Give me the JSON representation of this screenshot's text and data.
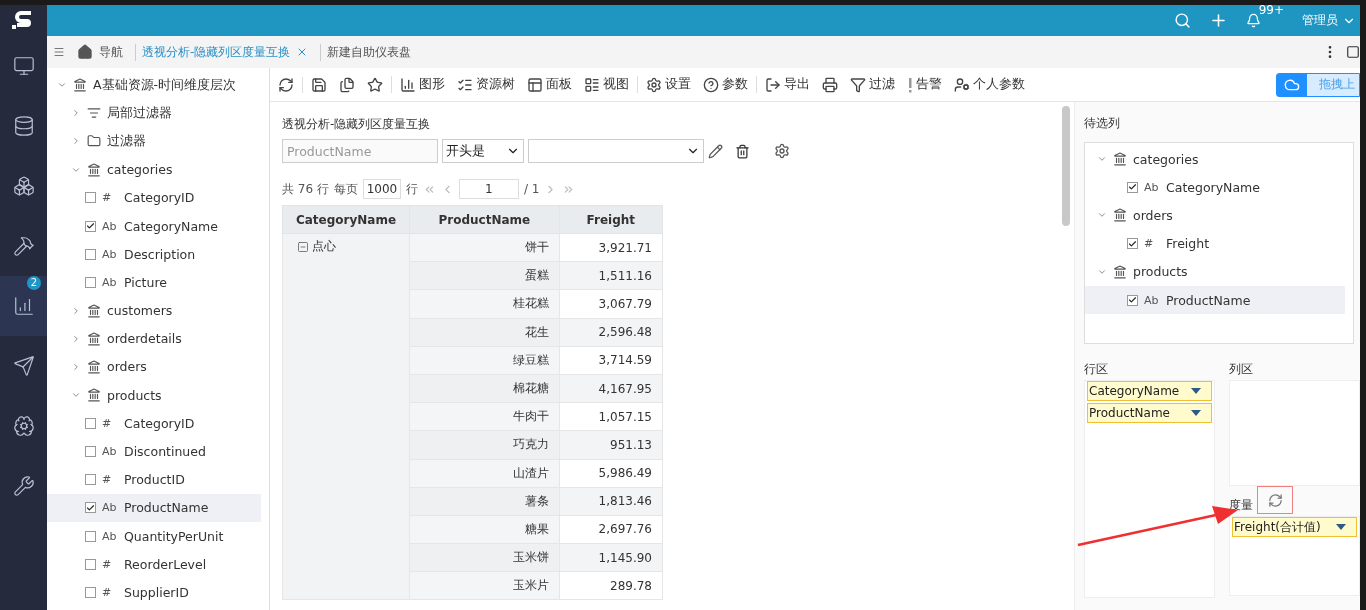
{
  "top_bar": {
    "notifications": "99+",
    "user": "管理员"
  },
  "nav": [
    {
      "kind": "monitor",
      "selected": false
    },
    {
      "kind": "database",
      "selected": false
    },
    {
      "kind": "boxes",
      "selected": false
    },
    {
      "kind": "hammer",
      "selected": false
    },
    {
      "kind": "chart",
      "selected": true,
      "badge": "2"
    },
    {
      "kind": "send",
      "selected": false
    },
    {
      "kind": "brain",
      "selected": false
    },
    {
      "kind": "wrench",
      "selected": false
    }
  ],
  "tabs": [
    {
      "label": "导航",
      "kind": "home",
      "selected": false
    },
    {
      "label": "透视分析-隐藏列区度量互换",
      "kind": "doc",
      "selected": true
    },
    {
      "label": "新建自助仪表盘",
      "kind": "doc",
      "selected": false
    }
  ],
  "tree": {
    "label": "A基础资源-时间维度层次",
    "expanded": true,
    "children": [
      {
        "kind": "filter",
        "label": "局部过滤器",
        "expanded": false
      },
      {
        "kind": "folder",
        "label": "过滤器",
        "expanded": false
      },
      {
        "kind": "table",
        "label": "categories",
        "expanded": true,
        "children": [
          {
            "kind": "field",
            "mark": "#",
            "label": "CategoryID",
            "checked": false,
            "selected": false
          },
          {
            "kind": "field",
            "mark": "Ab",
            "label": "CategoryName",
            "checked": true,
            "selected": false
          },
          {
            "kind": "field",
            "mark": "Ab",
            "label": "Description",
            "checked": false,
            "selected": false
          },
          {
            "kind": "field",
            "mark": "Ab",
            "label": "Picture",
            "checked": false,
            "selected": false
          }
        ]
      },
      {
        "kind": "table",
        "label": "customers",
        "expanded": false
      },
      {
        "kind": "table",
        "label": "orderdetails",
        "expanded": false
      },
      {
        "kind": "table",
        "label": "orders",
        "expanded": false
      },
      {
        "kind": "table",
        "label": "products",
        "expanded": true,
        "children": [
          {
            "kind": "field",
            "mark": "#",
            "label": "CategoryID",
            "checked": false,
            "selected": false
          },
          {
            "kind": "field",
            "mark": "Ab",
            "label": "Discontinued",
            "checked": false,
            "selected": false
          },
          {
            "kind": "field",
            "mark": "#",
            "label": "ProductID",
            "checked": false,
            "selected": false
          },
          {
            "kind": "field",
            "mark": "Ab",
            "label": "ProductName",
            "checked": true,
            "selected": true
          },
          {
            "kind": "field",
            "mark": "Ab",
            "label": "QuantityPerUnit",
            "checked": false,
            "selected": false
          },
          {
            "kind": "field",
            "mark": "#",
            "label": "ReorderLevel",
            "checked": false,
            "selected": false
          },
          {
            "kind": "field",
            "mark": "#",
            "label": "SupplierID",
            "checked": false,
            "selected": false
          }
        ]
      }
    ]
  },
  "toolbar": [
    [
      {
        "kind": "refresh"
      }
    ],
    [
      {
        "kind": "save"
      },
      {
        "kind": "save_as"
      },
      {
        "kind": "favorite"
      }
    ],
    [
      {
        "kind": "chart",
        "label": "图形"
      },
      {
        "kind": "resource_tree",
        "label": "资源树"
      },
      {
        "kind": "panel",
        "label": "面板"
      },
      {
        "kind": "view",
        "label": "视图"
      }
    ],
    [
      {
        "kind": "settings",
        "label": "设置"
      },
      {
        "kind": "params",
        "label": "参数"
      }
    ],
    [
      {
        "kind": "export",
        "label": "导出"
      },
      {
        "kind": "print"
      },
      {
        "kind": "filter",
        "label": "过滤"
      },
      {
        "kind": "alert",
        "label": "告警"
      },
      {
        "kind": "user_params",
        "label": "个人参数"
      }
    ]
  ],
  "upload_button": "拖拽上",
  "report": {
    "title": "透视分析-隐藏列区度量互换",
    "filter": {
      "field_placeholder": "ProductName",
      "operator": "开头是"
    },
    "paging": {
      "total": "共 76 行",
      "per_page_label": "每页",
      "per_page": "1000",
      "unit": "行",
      "page": "1",
      "page_total": "/ 1"
    },
    "table": {
      "columns": [
        "CategoryName",
        "ProductName",
        "Freight"
      ],
      "groups": [
        {
          "category": "点心",
          "expanded": true,
          "rows": [
            [
              "饼干",
              "3,921.71"
            ],
            [
              "蛋糕",
              "1,511.16"
            ],
            [
              "桂花糕",
              "3,067.79"
            ],
            [
              "花生",
              "2,596.48"
            ],
            [
              "绿豆糕",
              "3,714.59"
            ],
            [
              "棉花糖",
              "4,167.95"
            ],
            [
              "牛肉干",
              "1,057.15"
            ],
            [
              "巧克力",
              "951.13"
            ],
            [
              "山渣片",
              "5,986.49"
            ],
            [
              "薯条",
              "1,813.46"
            ],
            [
              "糖果",
              "2,697.76"
            ],
            [
              "玉米饼",
              "1,145.90"
            ],
            [
              "玉米片",
              "289.78"
            ]
          ]
        }
      ]
    }
  },
  "right_panel": {
    "candidates_title": "待选列",
    "candidates": [
      {
        "label": "categories",
        "expanded": true,
        "fields": [
          {
            "mark": "Ab",
            "label": "CategoryName",
            "checked": true,
            "selected": false
          }
        ]
      },
      {
        "label": "orders",
        "expanded": true,
        "fields": [
          {
            "mark": "#",
            "label": "Freight",
            "checked": true,
            "selected": false
          }
        ]
      },
      {
        "label": "products",
        "expanded": true,
        "fields": [
          {
            "mark": "Ab",
            "label": "ProductName",
            "checked": true,
            "selected": true
          }
        ]
      }
    ],
    "row_zone": {
      "title": "行区",
      "fields": [
        "CategoryName",
        "ProductName"
      ]
    },
    "column_zone": {
      "title": "列区"
    },
    "measure_zone": {
      "title": "度量",
      "fields": [
        "Freight(合计值)"
      ]
    }
  }
}
